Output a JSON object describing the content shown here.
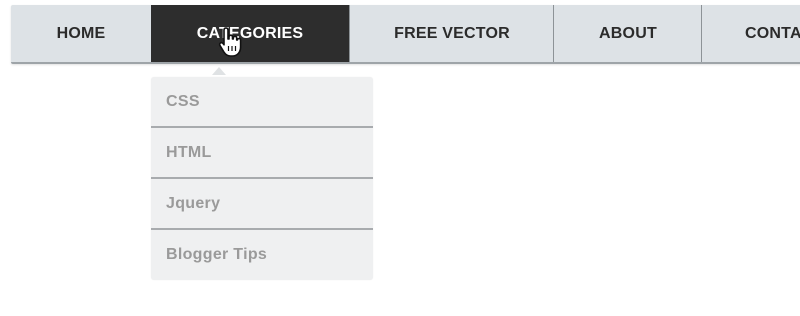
{
  "nav": {
    "items": [
      {
        "label": "HOME"
      },
      {
        "label": "CATEGORIES"
      },
      {
        "label": "FREE VECTOR"
      },
      {
        "label": "ABOUT"
      },
      {
        "label": "CONTA"
      }
    ],
    "active_color": "#2d2d2d",
    "bar_color": "#dde2e6"
  },
  "dropdown": {
    "items": [
      {
        "label": "CSS"
      },
      {
        "label": "HTML"
      },
      {
        "label": "Jquery"
      },
      {
        "label": "Blogger Tips"
      }
    ]
  },
  "icons": {
    "cursor": "hand-pointer-icon"
  }
}
